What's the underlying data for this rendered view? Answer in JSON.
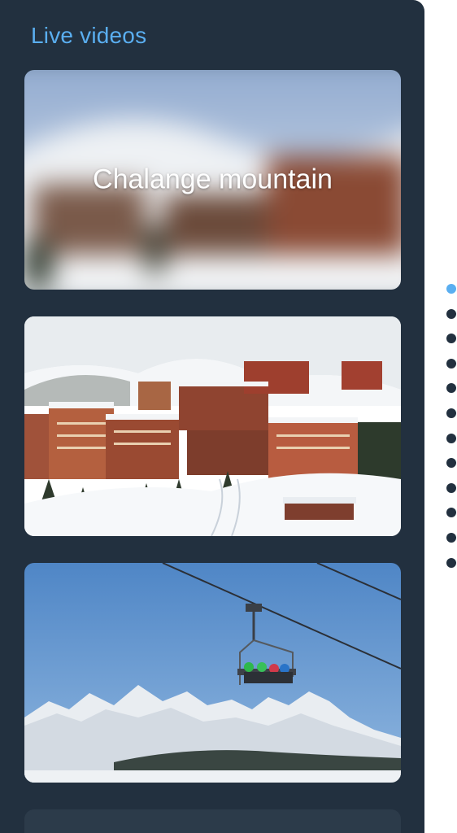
{
  "section": {
    "title": "Live videos"
  },
  "cards": [
    {
      "label": "Chalange mountain",
      "scene": "blurred-ski-resort"
    },
    {
      "label": "",
      "scene": "ski-resort-chalets"
    },
    {
      "label": "",
      "scene": "chairlift-mountains"
    },
    {
      "label": "",
      "scene": "partial"
    }
  ],
  "pagination": {
    "count": 12,
    "active_index": 0
  },
  "colors": {
    "panel": "#22303f",
    "accent": "#5aaef0",
    "inactive_dot": "#22303f"
  }
}
